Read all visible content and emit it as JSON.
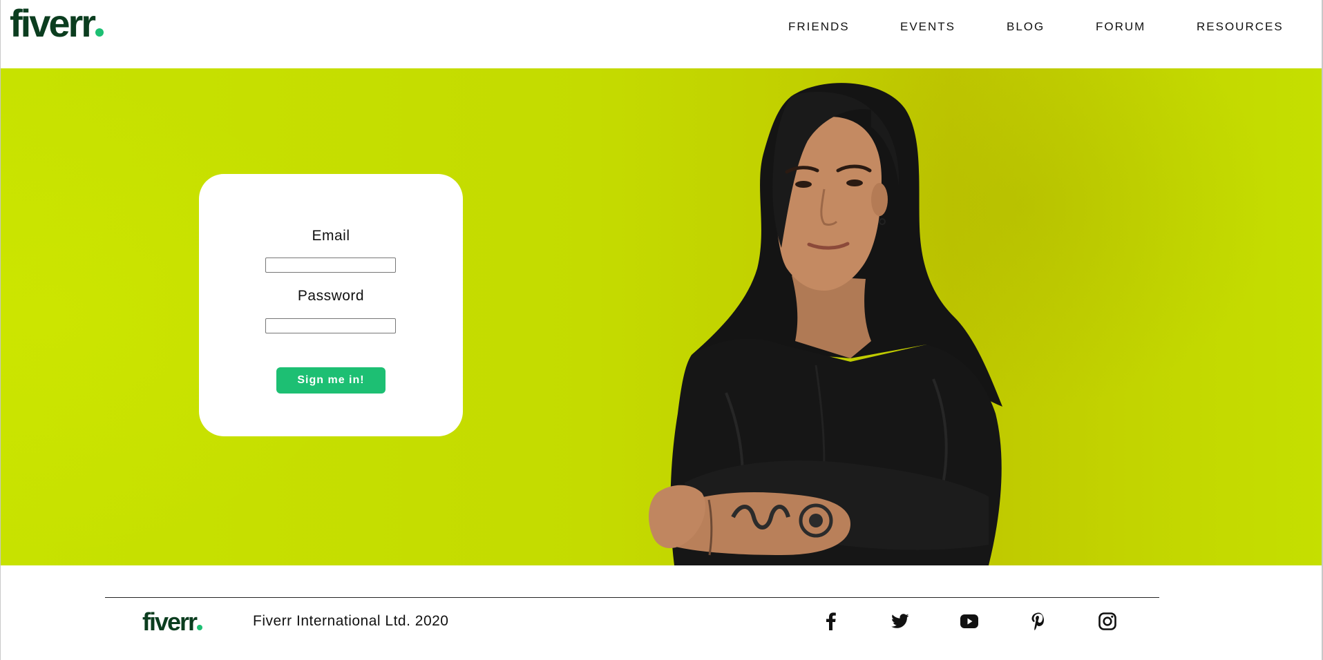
{
  "header": {
    "logo_text": "fiverr",
    "nav": [
      {
        "label": "FRIENDS"
      },
      {
        "label": "EVENTS"
      },
      {
        "label": "BLOG"
      },
      {
        "label": "FORUM"
      },
      {
        "label": "RESOURCES"
      }
    ]
  },
  "login": {
    "email_label": "Email",
    "email_value": "",
    "password_label": "Password",
    "password_value": "",
    "submit_label": "Sign me in!"
  },
  "footer": {
    "logo_text": "fiverr",
    "copyright": "Fiverr International Ltd. 2020",
    "social_icons": [
      "facebook-icon",
      "twitter-icon",
      "youtube-icon",
      "pinterest-icon",
      "instagram-icon"
    ]
  },
  "colors": {
    "brand_green": "#1dbf73",
    "logo_dark_green": "#0b3d1f",
    "hero_background": "#c4db00",
    "card_background": "#ffffff"
  }
}
